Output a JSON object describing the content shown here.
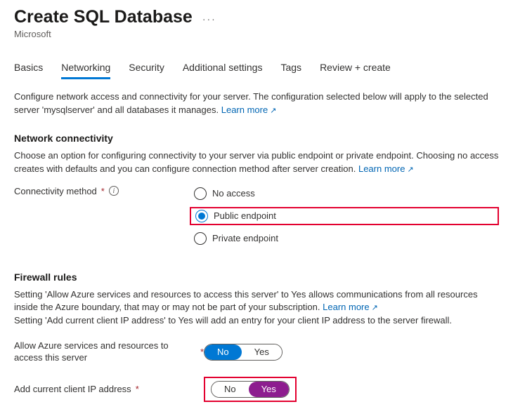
{
  "header": {
    "title": "Create SQL Database",
    "subtitle": "Microsoft"
  },
  "tabs": [
    {
      "label": "Basics",
      "selected": false
    },
    {
      "label": "Networking",
      "selected": true
    },
    {
      "label": "Security",
      "selected": false
    },
    {
      "label": "Additional settings",
      "selected": false
    },
    {
      "label": "Tags",
      "selected": false
    },
    {
      "label": "Review + create",
      "selected": false
    }
  ],
  "intro": {
    "text": "Configure network access and connectivity for your server. The configuration selected below will apply to the selected server 'mysqlserver' and all databases it manages.",
    "learn_more": "Learn more"
  },
  "network": {
    "section_title": "Network connectivity",
    "desc": "Choose an option for configuring connectivity to your server via public endpoint or private endpoint. Choosing no access creates with defaults and you can configure connection method after server creation.",
    "learn_more": "Learn more",
    "method_label": "Connectivity method",
    "options": {
      "no_access": "No access",
      "public": "Public endpoint",
      "private": "Private endpoint"
    },
    "selected": "public"
  },
  "firewall": {
    "section_title": "Firewall rules",
    "desc1a": "Setting 'Allow Azure services and resources to access this server' to Yes allows communications from all resources inside the Azure boundary, that may or may not be part of your subscription.",
    "learn_more": "Learn more",
    "desc2": "Setting 'Add current client IP address' to Yes will add an entry for your client IP address to the server firewall.",
    "allow_azure": {
      "label": "Allow Azure services and resources to access this server",
      "no": "No",
      "yes": "Yes",
      "value": "No"
    },
    "add_client_ip": {
      "label": "Add current client IP address",
      "no": "No",
      "yes": "Yes",
      "value": "Yes"
    }
  }
}
